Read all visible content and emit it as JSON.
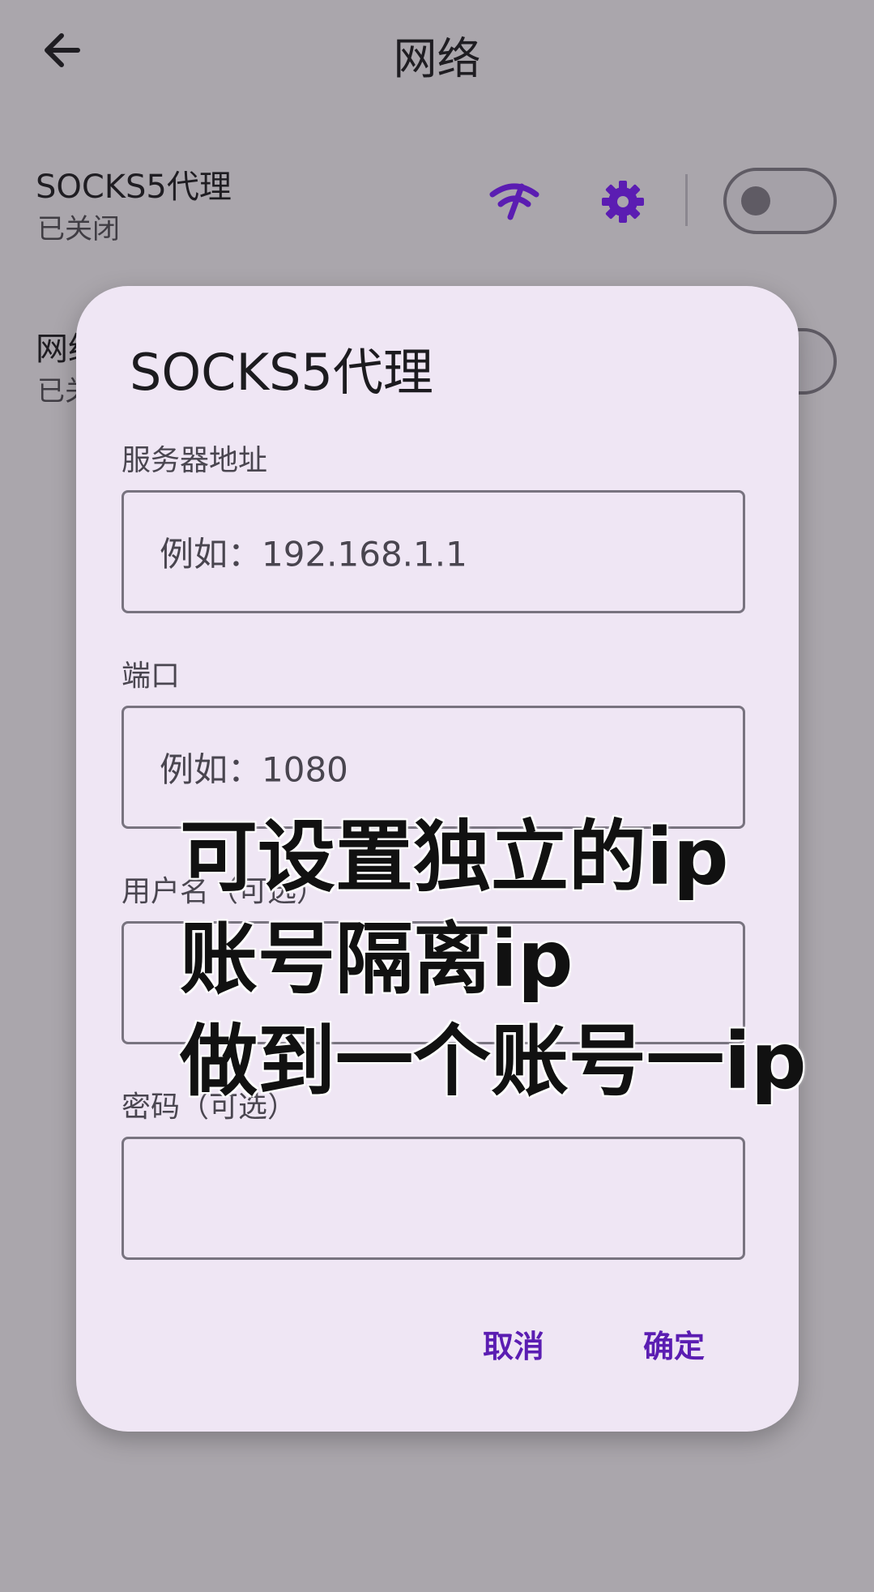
{
  "header": {
    "title": "网络"
  },
  "settings": {
    "socks_row": {
      "title": "SOCKS5代理",
      "status": "已关闭"
    },
    "network_row": {
      "title": "网络",
      "status": "已关闭"
    }
  },
  "icons": {
    "back": "arrow-back-icon",
    "wifi": "network-speed-icon",
    "gear": "gear-icon"
  },
  "dialog": {
    "title": "SOCKS5代理",
    "fields": [
      {
        "label": "服务器地址",
        "placeholder": "例如：192.168.1.1"
      },
      {
        "label": "端口",
        "placeholder": "例如：1080"
      },
      {
        "label": "用户名（可选）",
        "placeholder": ""
      },
      {
        "label": "密码（可选）",
        "placeholder": ""
      }
    ],
    "cancel": "取消",
    "ok": "确定"
  },
  "overlay": {
    "line1": "可设置独立的ip",
    "line2": "账号隔离ip",
    "line3": "做到一个账号一ip"
  },
  "colors": {
    "accent": "#5b1db2",
    "dialog_bg": "#efe6f4",
    "scrim": "#aaa6ac"
  }
}
